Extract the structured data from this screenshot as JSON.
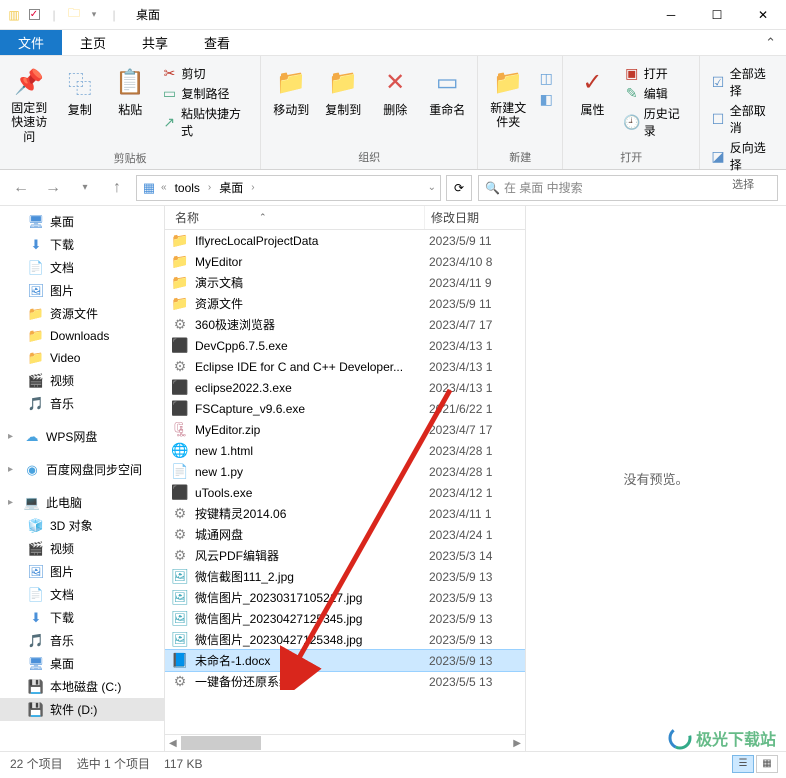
{
  "title": "桌面",
  "tabs": {
    "file": "文件",
    "home": "主页",
    "share": "共享",
    "view": "查看"
  },
  "ribbon": {
    "pin": "固定到快速访问",
    "copy": "复制",
    "paste": "粘贴",
    "copy_path": "复制路径",
    "paste_shortcut": "粘贴快捷方式",
    "cut": "剪切",
    "group_clipboard": "剪贴板",
    "move": "移动到",
    "copyto": "复制到",
    "delete": "删除",
    "rename": "重命名",
    "group_organize": "组织",
    "newfolder": "新建文件夹",
    "group_new": "新建",
    "props": "属性",
    "open": "打开",
    "edit": "编辑",
    "history": "历史记录",
    "group_open": "打开",
    "selall": "全部选择",
    "selnone": "全部取消",
    "selinv": "反向选择",
    "group_select": "选择"
  },
  "breadcrumb": {
    "seg1": "tools",
    "seg2": "桌面"
  },
  "search_placeholder": "在 桌面 中搜索",
  "sidebar": [
    {
      "label": "桌面",
      "level": 2,
      "icon": "desktop"
    },
    {
      "label": "下载",
      "level": 2,
      "icon": "download"
    },
    {
      "label": "文档",
      "level": 2,
      "icon": "doc"
    },
    {
      "label": "图片",
      "level": 2,
      "icon": "pic"
    },
    {
      "label": "资源文件",
      "level": 2,
      "icon": "folder"
    },
    {
      "label": "Downloads",
      "level": 2,
      "icon": "folder"
    },
    {
      "label": "Video",
      "level": 2,
      "icon": "folder"
    },
    {
      "label": "视频",
      "level": 2,
      "icon": "video"
    },
    {
      "label": "音乐",
      "level": 2,
      "icon": "music"
    },
    {
      "spacer": true
    },
    {
      "label": "WPS网盘",
      "level": 1,
      "icon": "wps"
    },
    {
      "spacer": true
    },
    {
      "label": "百度网盘同步空间",
      "level": 1,
      "icon": "baidu"
    },
    {
      "spacer": true
    },
    {
      "label": "此电脑",
      "level": 1,
      "icon": "pc"
    },
    {
      "label": "3D 对象",
      "level": 2,
      "icon": "3d"
    },
    {
      "label": "视频",
      "level": 2,
      "icon": "video"
    },
    {
      "label": "图片",
      "level": 2,
      "icon": "pic"
    },
    {
      "label": "文档",
      "level": 2,
      "icon": "doc"
    },
    {
      "label": "下载",
      "level": 2,
      "icon": "download"
    },
    {
      "label": "音乐",
      "level": 2,
      "icon": "music"
    },
    {
      "label": "桌面",
      "level": 2,
      "icon": "desktop"
    },
    {
      "label": "本地磁盘 (C:)",
      "level": 2,
      "icon": "drive"
    },
    {
      "label": "软件 (D:)",
      "level": 2,
      "icon": "drive",
      "hi": true
    }
  ],
  "headers": {
    "name": "名称",
    "date": "修改日期"
  },
  "files": [
    {
      "name": "IflyrecLocalProjectData",
      "date": "2023/5/9 11",
      "type": "folder"
    },
    {
      "name": "MyEditor",
      "date": "2023/4/10 8",
      "type": "folder"
    },
    {
      "name": "演示文稿",
      "date": "2023/4/11 9",
      "type": "folder"
    },
    {
      "name": "资源文件",
      "date": "2023/5/9 11",
      "type": "folder"
    },
    {
      "name": "360极速浏览器",
      "date": "2023/4/7 17",
      "type": "app"
    },
    {
      "name": "DevCpp6.7.5.exe",
      "date": "2023/4/13 1",
      "type": "exe"
    },
    {
      "name": "Eclipse IDE for C and C++ Developer...",
      "date": "2023/4/13 1",
      "type": "app"
    },
    {
      "name": "eclipse2022.3.exe",
      "date": "2023/4/13 1",
      "type": "exe"
    },
    {
      "name": "FSCapture_v9.6.exe",
      "date": "2021/6/22 1",
      "type": "exe"
    },
    {
      "name": "MyEditor.zip",
      "date": "2023/4/7 17",
      "type": "zip"
    },
    {
      "name": "new 1.html",
      "date": "2023/4/28 1",
      "type": "html"
    },
    {
      "name": "new 1.py",
      "date": "2023/4/28 1",
      "type": "py"
    },
    {
      "name": "uTools.exe",
      "date": "2023/4/12 1",
      "type": "exe"
    },
    {
      "name": "按键精灵2014.06",
      "date": "2023/4/11 1",
      "type": "app"
    },
    {
      "name": "城通网盘",
      "date": "2023/4/24 1",
      "type": "app"
    },
    {
      "name": "风云PDF编辑器",
      "date": "2023/5/3 14",
      "type": "app"
    },
    {
      "name": "微信截图111_2.jpg",
      "date": "2023/5/9 13",
      "type": "jpg"
    },
    {
      "name": "微信图片_20230317105217.jpg",
      "date": "2023/5/9 13",
      "type": "jpg"
    },
    {
      "name": "微信图片_20230427125345.jpg",
      "date": "2023/5/9 13",
      "type": "jpg"
    },
    {
      "name": "微信图片_20230427125348.jpg",
      "date": "2023/5/9 13",
      "type": "jpg"
    },
    {
      "name": "未命名-1.docx",
      "date": "2023/5/9 13",
      "type": "docx",
      "selected": true
    },
    {
      "name": "一键备份还原系统",
      "date": "2023/5/5 13",
      "type": "app"
    }
  ],
  "preview_text": "没有预览。",
  "status": {
    "count": "22 个项目",
    "selected": "选中 1 个项目",
    "size": "117 KB"
  },
  "watermark": "极光下载站"
}
